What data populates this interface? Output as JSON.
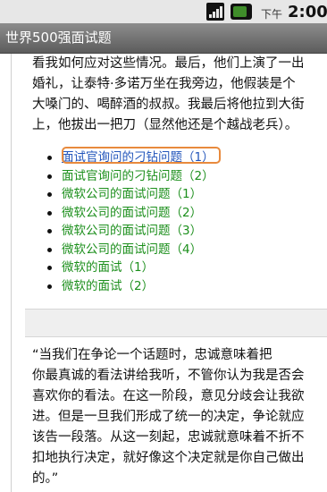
{
  "status_bar": {
    "time_prefix": "下午",
    "time": "2:00",
    "signal_icon": "signal-strength-icon",
    "battery_icon": "battery-icon"
  },
  "app": {
    "title": "世界500强面试题"
  },
  "article": {
    "lines": [
      "看我如何应对这些情况。最后，他们上演了一出",
      "婚礼，让泰特·多诺万坐在我旁边，他假装是个",
      "大嗓门的、喝醉酒的叔叔。我最后将他拉到大街",
      "上，他拔出一把刀（显然他还是个越战老兵）。"
    ]
  },
  "links": [
    "面试官询问的刁钻问题（1）",
    "面试官询问的刁钻问题（2）",
    "微软公司的面试问题（1）",
    "微软公司的面试问题（2）",
    "微软公司的面试问题（3）",
    "微软公司的面试问题（4）",
    "微软的面试（1）",
    "微软的面试（2）"
  ],
  "quote": {
    "lines": [
      "“当我们在争论一个话题时，忠诚意味着把",
      "你最真诚的看法讲给我听，不管你认为我是否会",
      "喜欢你的看法。在这一阶段，意见分歧会让我欲",
      "进。但是一旦我们形成了统一的决定，争论就应",
      "该告一段落。从这一刻起，忠诚就意味着不折不",
      "扣地执行决定，就好像这个决定就是你自己做出",
      "的。”"
    ]
  },
  "colors": {
    "link_visited": "#1c8f1c",
    "link_active": "#2255bb",
    "focus_ring": "#e88a3d",
    "title_bar": "#6d6d6d"
  }
}
